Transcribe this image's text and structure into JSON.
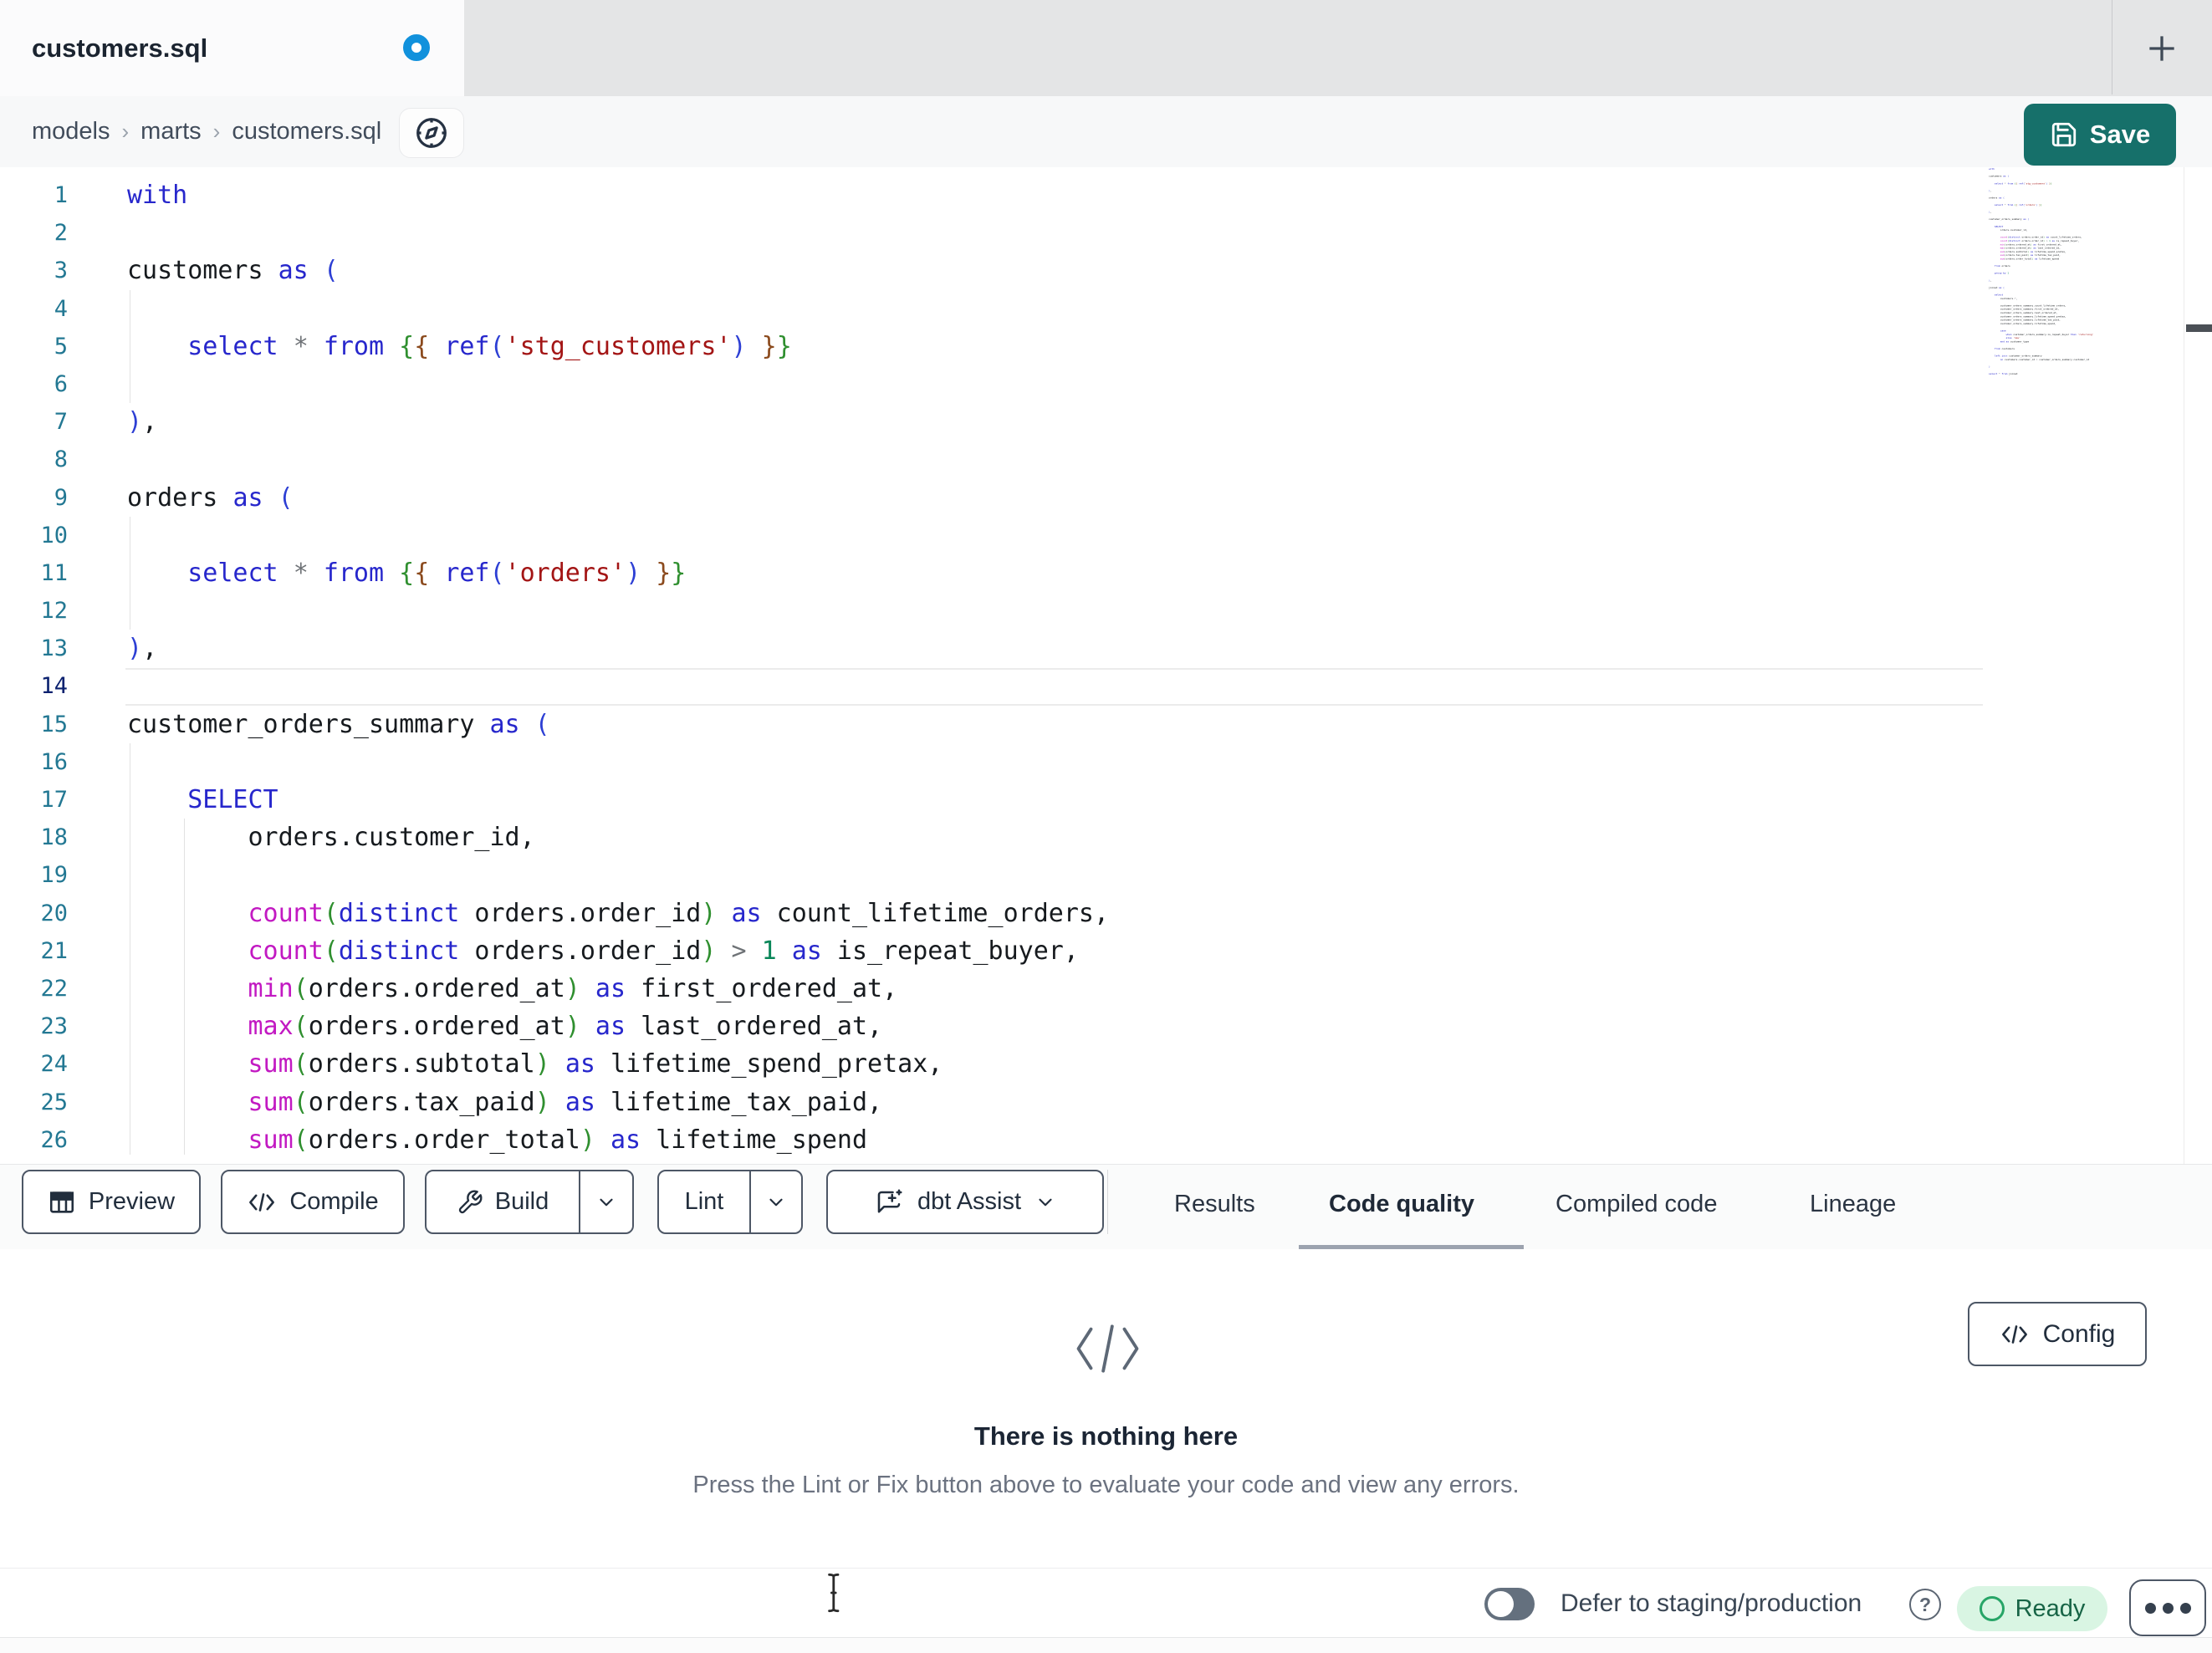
{
  "tab": {
    "title": "customers.sql",
    "unsaved": true
  },
  "new_tab_icon": "plus-icon",
  "breadcrumb": {
    "items": [
      "models",
      "marts",
      "customers.sql"
    ],
    "separator": "›"
  },
  "save": {
    "label": "Save",
    "color": "#16706a"
  },
  "editor": {
    "active_line": 14,
    "token_colors": {
      "kw": "#2727cc",
      "fn": "#c219c2",
      "id": "#161a1e",
      "str": "#a31515",
      "num": "#098658",
      "op": "#6f7377",
      "b1": "#2d3fd4",
      "b2": "#2f8f2f",
      "b3": "#8b4a1d"
    },
    "line_number_color": "#237893",
    "active_line_number_color": "#0b216f",
    "lines": [
      [
        [
          "kw",
          "with"
        ]
      ],
      [],
      [
        [
          "id",
          "customers "
        ],
        [
          "kw",
          "as "
        ],
        [
          "b1",
          "("
        ]
      ],
      [],
      [
        [
          "id",
          "    "
        ],
        [
          "kw",
          "select "
        ],
        [
          "op",
          "* "
        ],
        [
          "kw",
          "from "
        ],
        [
          "b2",
          "{"
        ],
        [
          "b3",
          "{"
        ],
        [
          "id",
          " "
        ],
        [
          "kw",
          "ref"
        ],
        [
          "b1",
          "("
        ],
        [
          "str",
          "'stg_customers'"
        ],
        [
          "b1",
          ")"
        ],
        [
          "id",
          " "
        ],
        [
          "b3",
          "}"
        ],
        [
          "b2",
          "}"
        ]
      ],
      [],
      [
        [
          "b1",
          ")"
        ],
        [
          "id",
          ","
        ]
      ],
      [],
      [
        [
          "id",
          "orders "
        ],
        [
          "kw",
          "as "
        ],
        [
          "b1",
          "("
        ]
      ],
      [],
      [
        [
          "id",
          "    "
        ],
        [
          "kw",
          "select "
        ],
        [
          "op",
          "* "
        ],
        [
          "kw",
          "from "
        ],
        [
          "b2",
          "{"
        ],
        [
          "b3",
          "{"
        ],
        [
          "id",
          " "
        ],
        [
          "kw",
          "ref"
        ],
        [
          "b1",
          "("
        ],
        [
          "str",
          "'orders'"
        ],
        [
          "b1",
          ")"
        ],
        [
          "id",
          " "
        ],
        [
          "b3",
          "}"
        ],
        [
          "b2",
          "}"
        ]
      ],
      [],
      [
        [
          "b1",
          ")"
        ],
        [
          "id",
          ","
        ]
      ],
      [],
      [
        [
          "id",
          "customer_orders_summary "
        ],
        [
          "kw",
          "as "
        ],
        [
          "b1",
          "("
        ]
      ],
      [],
      [
        [
          "id",
          "    "
        ],
        [
          "kw",
          "SELECT"
        ]
      ],
      [
        [
          "id",
          "        orders.customer_id,"
        ]
      ],
      [],
      [
        [
          "id",
          "        "
        ],
        [
          "fn",
          "count"
        ],
        [
          "b2",
          "("
        ],
        [
          "kw",
          "distinct"
        ],
        [
          "id",
          " orders.order_id"
        ],
        [
          "b2",
          ")"
        ],
        [
          "id",
          " "
        ],
        [
          "kw",
          "as"
        ],
        [
          "id",
          " count_lifetime_orders,"
        ]
      ],
      [
        [
          "id",
          "        "
        ],
        [
          "fn",
          "count"
        ],
        [
          "b2",
          "("
        ],
        [
          "kw",
          "distinct"
        ],
        [
          "id",
          " orders.order_id"
        ],
        [
          "b2",
          ")"
        ],
        [
          "id",
          " "
        ],
        [
          "op",
          ">"
        ],
        [
          "id",
          " "
        ],
        [
          "num",
          "1"
        ],
        [
          "id",
          " "
        ],
        [
          "kw",
          "as"
        ],
        [
          "id",
          " is_repeat_buyer,"
        ]
      ],
      [
        [
          "id",
          "        "
        ],
        [
          "fn",
          "min"
        ],
        [
          "b2",
          "("
        ],
        [
          "id",
          "orders.ordered_at"
        ],
        [
          "b2",
          ")"
        ],
        [
          "id",
          " "
        ],
        [
          "kw",
          "as"
        ],
        [
          "id",
          " first_ordered_at,"
        ]
      ],
      [
        [
          "id",
          "        "
        ],
        [
          "fn",
          "max"
        ],
        [
          "b2",
          "("
        ],
        [
          "id",
          "orders.ordered_at"
        ],
        [
          "b2",
          ")"
        ],
        [
          "id",
          " "
        ],
        [
          "kw",
          "as"
        ],
        [
          "id",
          " last_ordered_at,"
        ]
      ],
      [
        [
          "id",
          "        "
        ],
        [
          "fn",
          "sum"
        ],
        [
          "b2",
          "("
        ],
        [
          "id",
          "orders.subtotal"
        ],
        [
          "b2",
          ")"
        ],
        [
          "id",
          " "
        ],
        [
          "kw",
          "as"
        ],
        [
          "id",
          " lifetime_spend_pretax,"
        ]
      ],
      [
        [
          "id",
          "        "
        ],
        [
          "fn",
          "sum"
        ],
        [
          "b2",
          "("
        ],
        [
          "id",
          "orders.tax_paid"
        ],
        [
          "b2",
          ")"
        ],
        [
          "id",
          " "
        ],
        [
          "kw",
          "as"
        ],
        [
          "id",
          " lifetime_tax_paid,"
        ]
      ],
      [
        [
          "id",
          "        "
        ],
        [
          "fn",
          "sum"
        ],
        [
          "b2",
          "("
        ],
        [
          "id",
          "orders.order_total"
        ],
        [
          "b2",
          ")"
        ],
        [
          "id",
          " "
        ],
        [
          "kw",
          "as"
        ],
        [
          "id",
          " lifetime_spend"
        ]
      ]
    ],
    "minimap_extra": [
      [],
      [
        [
          "id",
          "    "
        ],
        [
          "kw",
          "from"
        ],
        [
          "id",
          " orders"
        ]
      ],
      [],
      [
        [
          "id",
          "    "
        ],
        [
          "kw",
          "group by"
        ],
        [
          "id",
          " "
        ],
        [
          "num",
          "1"
        ]
      ],
      [],
      [
        [
          "b1",
          ")"
        ],
        [
          "id",
          ","
        ]
      ],
      [],
      [
        [
          "id",
          "joined "
        ],
        [
          "kw",
          "as "
        ],
        [
          "b1",
          "("
        ]
      ],
      [],
      [
        [
          "id",
          "    "
        ],
        [
          "kw",
          "select"
        ]
      ],
      [
        [
          "id",
          "        customers."
        ],
        [
          "op",
          "*"
        ],
        [
          "id",
          ","
        ]
      ],
      [],
      [
        [
          "id",
          "        customer_orders_summary.count_lifetime_orders,"
        ]
      ],
      [
        [
          "id",
          "        customer_orders_summary.first_ordered_at,"
        ]
      ],
      [
        [
          "id",
          "        customer_orders_summary.last_ordered_at,"
        ]
      ],
      [
        [
          "id",
          "        customer_orders_summary.lifetime_spend_pretax,"
        ]
      ],
      [
        [
          "id",
          "        customer_orders_summary.lifetime_tax_paid,"
        ]
      ],
      [
        [
          "id",
          "        customer_orders_summary.lifetime_spend,"
        ]
      ],
      [],
      [
        [
          "id",
          "        "
        ],
        [
          "kw",
          "case"
        ]
      ],
      [
        [
          "id",
          "            "
        ],
        [
          "kw",
          "when"
        ],
        [
          "id",
          " customer_orders_summary.is_repeat_buyer "
        ],
        [
          "kw",
          "then"
        ],
        [
          "id",
          " "
        ],
        [
          "str",
          "'returning'"
        ]
      ],
      [
        [
          "id",
          "            "
        ],
        [
          "kw",
          "else"
        ],
        [
          "id",
          " "
        ],
        [
          "str",
          "'new'"
        ]
      ],
      [
        [
          "id",
          "        "
        ],
        [
          "kw",
          "end as"
        ],
        [
          "id",
          " customer_type"
        ]
      ],
      [],
      [
        [
          "id",
          "    "
        ],
        [
          "kw",
          "from"
        ],
        [
          "id",
          " customers"
        ]
      ],
      [],
      [
        [
          "id",
          "    "
        ],
        [
          "kw",
          "left join"
        ],
        [
          "id",
          " customer_orders_summary"
        ]
      ],
      [
        [
          "id",
          "        "
        ],
        [
          "kw",
          "on"
        ],
        [
          "id",
          " customers.customer_id "
        ],
        [
          "op",
          "="
        ],
        [
          "id",
          " customer_orders_summary.customer_id"
        ]
      ],
      [],
      [
        [
          "b1",
          ")"
        ]
      ],
      [],
      [
        [
          "kw",
          "select "
        ],
        [
          "op",
          "* "
        ],
        [
          "kw",
          "from"
        ],
        [
          "id",
          " joined"
        ]
      ]
    ]
  },
  "toolbar": {
    "preview": {
      "label": "Preview",
      "icon": "table-icon"
    },
    "compile": {
      "label": "Compile",
      "icon": "code-icon"
    },
    "build": {
      "label": "Build",
      "icon": "wrench-icon",
      "has_dropdown": true
    },
    "lint": {
      "label": "Lint",
      "has_dropdown": true
    },
    "dbt_assist": {
      "label": "dbt Assist",
      "icon": "assist-bubble-icon",
      "has_dropdown": true
    }
  },
  "result_tabs": {
    "results": {
      "label": "Results",
      "active": false
    },
    "code_quality": {
      "label": "Code quality",
      "active": true
    },
    "compiled_code": {
      "label": "Compiled code",
      "active": false
    },
    "lineage": {
      "label": "Lineage",
      "active": false
    }
  },
  "empty_state": {
    "title": "There is nothing here",
    "subtitle": "Press the Lint or Fix button above to evaluate your code and view any errors.",
    "icon": "code-icon"
  },
  "config": {
    "label": "Config",
    "icon": "code-icon"
  },
  "statusbar": {
    "defer_label": "Defer to staging/production",
    "toggle_on": false,
    "ready": {
      "label": "Ready",
      "bg": "#d9f5e3",
      "text_color": "#176446",
      "ring_color": "#27a567"
    }
  }
}
